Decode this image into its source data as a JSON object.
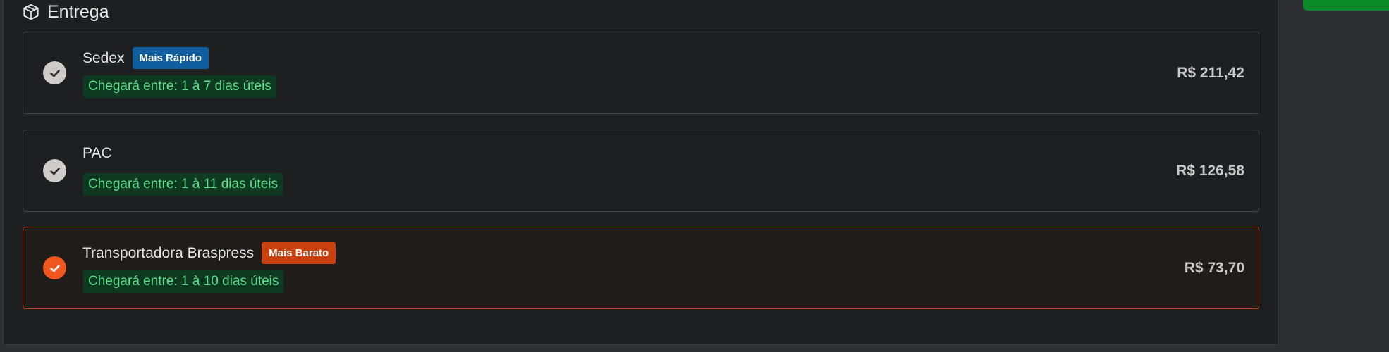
{
  "section": {
    "title": "Entrega",
    "icon": "package-icon"
  },
  "options": [
    {
      "name": "Sedex",
      "badge": "Mais Rápido",
      "badge_color": "#0f5fa0",
      "eta": "Chegará entre: 1 à 7 dias úteis",
      "price": "R$ 211,42",
      "selected": false
    },
    {
      "name": "PAC",
      "badge": "",
      "eta": "Chegará entre: 1 à 11 dias úteis",
      "price": "R$ 126,58",
      "selected": false
    },
    {
      "name": "Transportadora Braspress",
      "badge": "Mais Barato",
      "badge_color": "#c9410f",
      "eta": "Chegará entre: 1 à 10 dias úteis",
      "price": "R$ 73,70",
      "selected": true
    }
  ],
  "colors": {
    "selected_accent": "#f0571e",
    "unselected_check": "#cfcdca",
    "eta_text": "#5fe08d",
    "continue_button": "#0c8a2a"
  }
}
